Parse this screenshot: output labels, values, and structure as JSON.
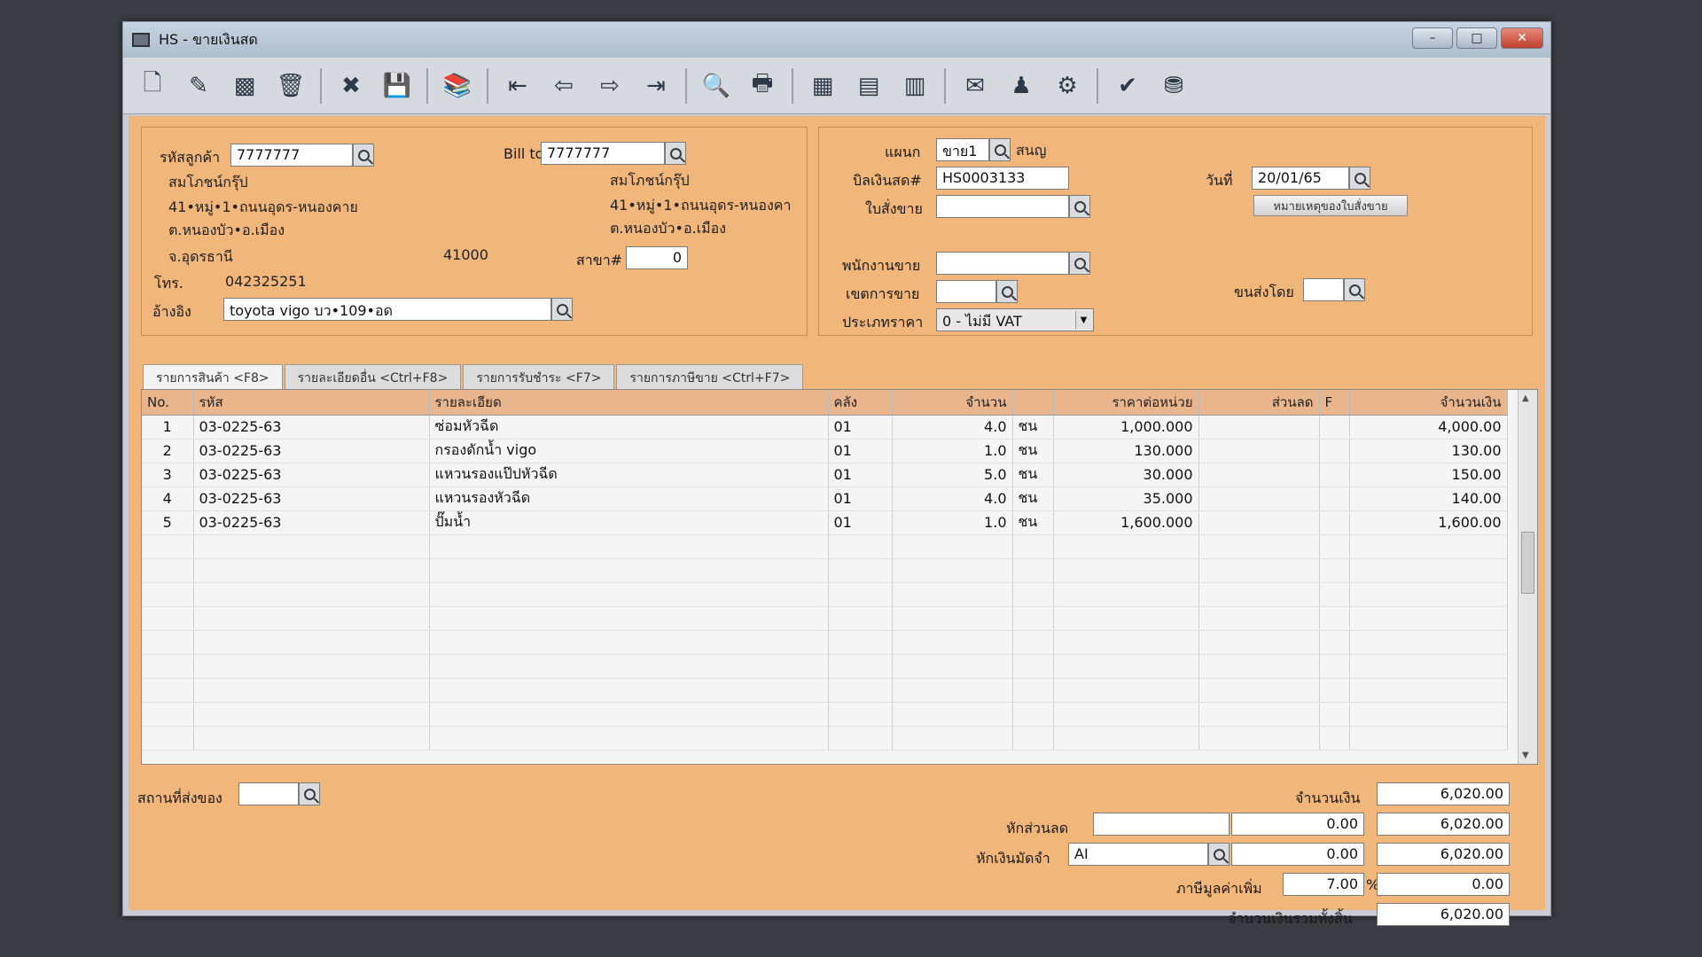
{
  "window": {
    "title": "HS - ขายเงินสด",
    "min": "–",
    "max": "□",
    "close": "✕"
  },
  "toolbar": {
    "buttons": [
      {
        "name": "new-doc-icon",
        "glyph": "🗋"
      },
      {
        "name": "edit-icon",
        "glyph": "✎"
      },
      {
        "name": "void-icon",
        "glyph": "▩"
      },
      {
        "name": "delete-icon",
        "glyph": "🗑"
      },
      {
        "name": "cancel-icon",
        "glyph": "✖"
      },
      {
        "name": "save-icon",
        "glyph": "💾"
      },
      {
        "name": "books-icon",
        "glyph": "📚"
      },
      {
        "name": "first-record-icon",
        "glyph": "⇤"
      },
      {
        "name": "prev-record-icon",
        "glyph": "⇦"
      },
      {
        "name": "next-record-icon",
        "glyph": "⇨"
      },
      {
        "name": "last-record-icon",
        "glyph": "⇥"
      },
      {
        "name": "preview-icon",
        "glyph": "🔍"
      },
      {
        "name": "print-icon",
        "glyph": "🖶"
      },
      {
        "name": "calculator-icon",
        "glyph": "▦"
      },
      {
        "name": "report-icon",
        "glyph": "▤"
      },
      {
        "name": "excel-icon",
        "glyph": "▥"
      },
      {
        "name": "email-icon",
        "glyph": "✉"
      },
      {
        "name": "user-icon",
        "glyph": "♟"
      },
      {
        "name": "tools-icon",
        "glyph": "⚙"
      },
      {
        "name": "ok-icon",
        "glyph": "✔"
      },
      {
        "name": "network-icon",
        "glyph": "⛃"
      }
    ]
  },
  "customer": {
    "code_label": "รหัสลูกค้า",
    "code": "7777777",
    "name": "สมโภชน์กรุ๊ป",
    "addr1": "41•หมู่•1•ถนนอุดร-หนองคาย",
    "addr2": "ต.หนองบัว•อ.เมือง",
    "addr3": "จ.อุดรธานี",
    "zip": "41000",
    "phone_label": "โทร.",
    "phone": "042325251",
    "ref_label": "อ้างอิง",
    "ref": "toyota vigo บว•109•อด"
  },
  "billto": {
    "label": "Bill to",
    "code": "7777777",
    "name": "สมโภชน์กรุ๊ป",
    "addr1": "41•หมู่•1•ถนนอุดร-หนองคา",
    "addr2": "ต.หนองบัว•อ.เมือง",
    "branch_label": "สาขา#",
    "branch": "0"
  },
  "doc": {
    "dept_label": "แผนก",
    "dept": "ขาย1",
    "dept_name": "สนญ",
    "bill_label": "บิลเงินสด#",
    "bill": "HS0003133",
    "date_label": "วันที่",
    "date": "20/01/65",
    "so_label": "ใบสั่งขาย",
    "so": "",
    "so_note_button": "หมายเหตุของใบสั่งขาย",
    "salesman_label": "พนักงานขาย",
    "salesman": "",
    "area_label": "เขตการขาย",
    "area": "",
    "ship_label": "ขนส่งโดย",
    "ship": "",
    "price_type_label": "ประเภทราคา",
    "price_type": "0 - ไม่มี VAT"
  },
  "tabs": [
    "รายการสินค้า <F8>",
    "รายละเอียดอื่น <Ctrl+F8>",
    "รายการรับชำระ <F7>",
    "รายการภาษีขาย <Ctrl+F7>"
  ],
  "table": {
    "headers": [
      "No.",
      "รหัส",
      "รายละเอียด",
      "คลัง",
      "จำนวน",
      "",
      "ราคาต่อหน่วย",
      "ส่วนลด",
      "F",
      "จำนวนเงิน"
    ],
    "rows": [
      [
        "1",
        "03-0225-63",
        "ซ่อมหัวฉีด",
        "01",
        "4.0",
        "ชน",
        "1,000.000",
        "",
        "",
        "4,000.00"
      ],
      [
        "2",
        "03-0225-63",
        "กรองดักน้ำ vigo",
        "01",
        "1.0",
        "ชน",
        "130.000",
        "",
        "",
        "130.00"
      ],
      [
        "3",
        "03-0225-63",
        "แหวนรองแป๊ปหัวฉีด",
        "01",
        "5.0",
        "ชน",
        "30.000",
        "",
        "",
        "150.00"
      ],
      [
        "4",
        "03-0225-63",
        "แหวนรองหัวฉีด",
        "01",
        "4.0",
        "ชน",
        "35.000",
        "",
        "",
        "140.00"
      ],
      [
        "5",
        "03-0225-63",
        "ปั๊มน้ำ",
        "01",
        "1.0",
        "ชน",
        "1,600.000",
        "",
        "",
        "1,600.00"
      ]
    ]
  },
  "footer": {
    "ship_place_label": "สถานที่ส่งของ",
    "ship_place": "",
    "amount_label": "จำนวนเงิน",
    "amount": "6,020.00",
    "discount_label": "หักส่วนลด",
    "discount_text": "",
    "discount_value": "0.00",
    "after_discount": "6,020.00",
    "deposit_label": "หักเงินมัดจำ",
    "deposit_code": "AI",
    "deposit_value": "0.00",
    "after_deposit": "6,020.00",
    "vat_label": "ภาษีมูลค่าเพิ่ม",
    "vat_rate": "7.00",
    "vat_pct": "%",
    "vat_value": "0.00",
    "total_label": "จำนวนเงินรวมทั้งสิ้น",
    "total": "6,020.00"
  }
}
